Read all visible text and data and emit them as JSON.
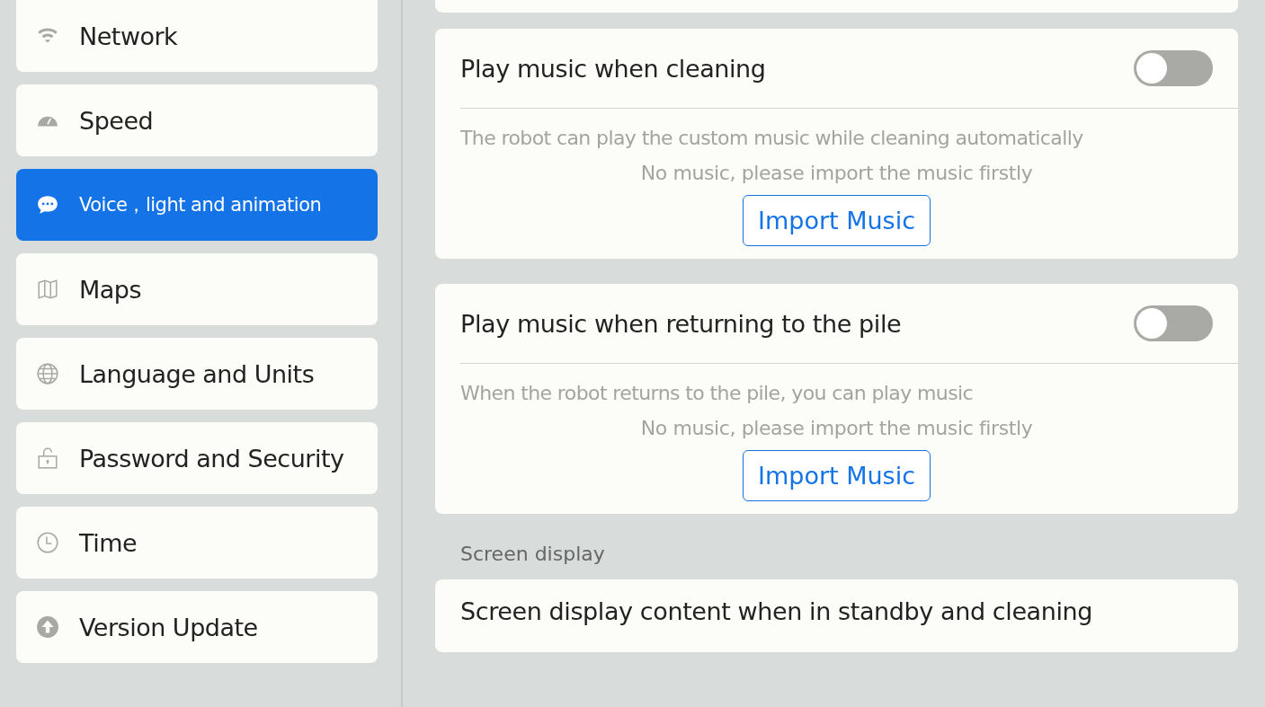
{
  "sidebar": {
    "items": [
      {
        "label": "Network",
        "selected": false
      },
      {
        "label": "Speed",
        "selected": false
      },
      {
        "label": "Voice，light and animation",
        "selected": true
      },
      {
        "label": "Maps",
        "selected": false
      },
      {
        "label": "Language and Units",
        "selected": false
      },
      {
        "label": "Password and Security",
        "selected": false
      },
      {
        "label": "Time",
        "selected": false
      },
      {
        "label": "Version Update",
        "selected": false
      }
    ]
  },
  "cards": [
    {
      "title": "Play music when cleaning",
      "on": false,
      "description": "The robot can play the custom music while cleaning automatically",
      "status": "No music, please import the music firstly",
      "button": "Import Music"
    },
    {
      "title": "Play music when returning to the pile",
      "on": false,
      "description": "When the robot returns to the pile, you can play music",
      "status": "No music, please import the music firstly",
      "button": "Import Music"
    }
  ],
  "section": {
    "heading": "Screen display",
    "card_title": "Screen display content when in standby and cleaning"
  }
}
